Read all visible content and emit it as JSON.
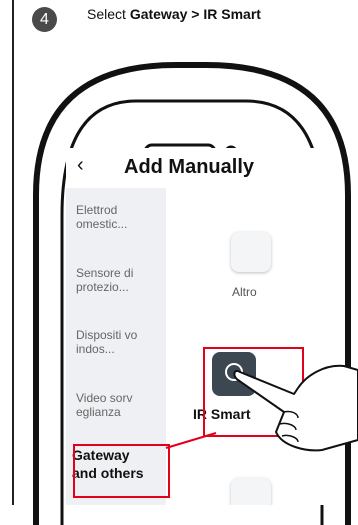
{
  "step": {
    "number": "4"
  },
  "instruction": {
    "prefix": "Select ",
    "path": "Gateway > IR Smart"
  },
  "screen": {
    "back_icon": "‹",
    "title": "Add Manually",
    "categories": [
      {
        "label": "Elettrod omestic..."
      },
      {
        "label": "Sensore di protezio..."
      },
      {
        "label": "Dispositi vo indos..."
      },
      {
        "label": "Video sorv eglianza"
      },
      {
        "label": "Gateway and others"
      }
    ],
    "devices": [
      {
        "label": "Altro"
      },
      {
        "label": "IR Smart"
      }
    ]
  },
  "colors": {
    "highlight": "#e3001b",
    "ir_tile": "#3c4752",
    "sidebar": "#eef0f3"
  }
}
